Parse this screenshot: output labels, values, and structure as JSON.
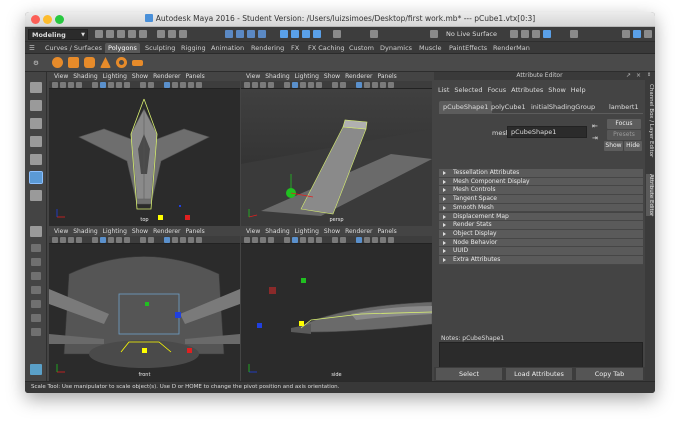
{
  "window": {
    "title": "Autodesk Maya 2016 - Student Version: /Users/luizsimoes/Desktop/first work.mb*   ---   pCube1.vtx[0:3]"
  },
  "status_line": {
    "mode": "Modeling",
    "live_surface": "No Live Surface"
  },
  "shelf": {
    "tabs": [
      "Curves / Surfaces",
      "Polygons",
      "Sculpting",
      "Rigging",
      "Animation",
      "Rendering",
      "FX",
      "FX Caching",
      "Custom",
      "Dynamics",
      "Muscle",
      "PaintEffects",
      "RenderMan"
    ],
    "active_tab": "Polygons"
  },
  "viewport_menu": [
    "View",
    "Shading",
    "Lighting",
    "Show",
    "Renderer",
    "Panels"
  ],
  "viewports": {
    "top_left": {
      "label": "top"
    },
    "top_right": {
      "label": "persp"
    },
    "bottom_left": {
      "label": "front"
    },
    "bottom_right": {
      "label": "side"
    }
  },
  "attribute_editor": {
    "title": "Attribute Editor",
    "menu": [
      "List",
      "Selected",
      "Focus",
      "Attributes",
      "Show",
      "Help"
    ],
    "tabs": [
      "pCubeShape1",
      "polyCube1",
      "initialShadingGroup",
      "lambert1"
    ],
    "active_tab": "pCubeShape1",
    "mesh_label": "mesh:",
    "mesh_value": "pCubeShape1",
    "focus_button": "Focus",
    "presets_button": "Presets",
    "show_button": "Show",
    "hide_button": "Hide",
    "sections": [
      "Tessellation Attributes",
      "Mesh Component Display",
      "Mesh Controls",
      "Tangent Space",
      "Smooth Mesh",
      "Displacement Map",
      "Render Stats",
      "Object Display",
      "Node Behavior",
      "UUID",
      "Extra Attributes"
    ],
    "notes_label": "Notes:  pCubeShape1",
    "select_button": "Select",
    "load_attributes_button": "Load Attributes",
    "copy_tab_button": "Copy Tab"
  },
  "side_tabs": [
    "Channel Box / Layer Editor",
    "Attribute Editor"
  ],
  "help_line": "Scale Tool: Use manipulator to scale object(s). Use D or HOME to change the pivot position and axis orientation.",
  "colors": {
    "panel_bg": "#444444",
    "viewport_bg": "#2d2d2d",
    "selection_yellow": "#ffff00",
    "manip_red": "#e02020",
    "manip_green": "#20c020",
    "manip_blue": "#2040e0",
    "shelf_orange": "#e78b2a"
  }
}
